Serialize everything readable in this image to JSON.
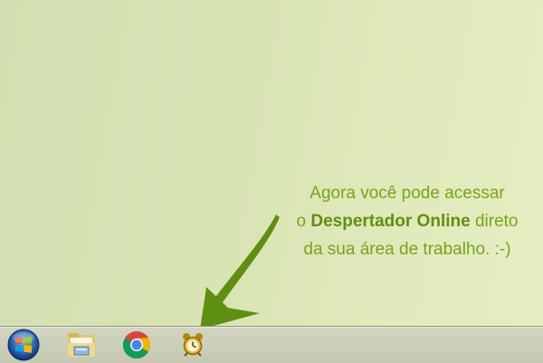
{
  "message": {
    "line1": "Agora você pode acessar",
    "line2_prefix": "o ",
    "line2_bold": "Despertador Online",
    "line2_suffix": " direto",
    "line3": "da sua área de trabalho. :-)"
  },
  "colors": {
    "text": "#76a51a",
    "arrow": "#5f8f10",
    "taskbar": "#c4c9b0"
  },
  "taskbar": {
    "items": [
      {
        "icon": "windows-start-orb-icon"
      },
      {
        "icon": "file-explorer-folder-icon"
      },
      {
        "icon": "chrome-icon"
      },
      {
        "icon": "alarm-clock-icon"
      }
    ]
  }
}
